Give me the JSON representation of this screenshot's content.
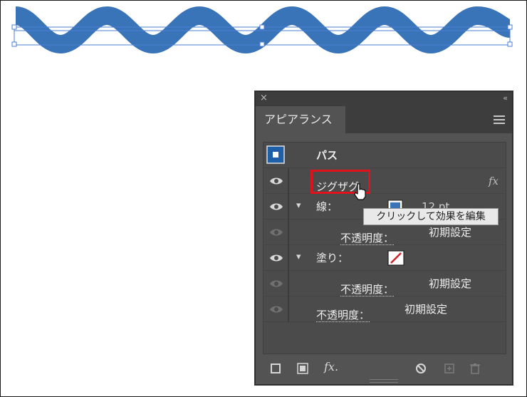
{
  "panel": {
    "tab_label": "アピアランス",
    "close_glyph": "×",
    "collapse_glyph": "‹‹"
  },
  "object": {
    "label": "パス"
  },
  "rows": {
    "effect_label": "ジグザグ",
    "fx_glyph": "fx",
    "stroke_label": "線：",
    "stroke_weight_partial": "12 pt",
    "stroke_opacity_label": "不透明度：",
    "stroke_opacity_value": "初期設定",
    "fill_label": "塗り：",
    "fill_opacity_label": "不透明度：",
    "fill_opacity_value": "初期設定",
    "object_opacity_label": "不透明度：",
    "object_opacity_value": "初期設定"
  },
  "tooltip": {
    "text": "クリックして効果を編集"
  },
  "bottom": {
    "fx_glyph": "fx."
  },
  "colors": {
    "wave": "#3a74b8",
    "selection": "#4a7fd6",
    "highlight": "#e0121c",
    "panel_bg": "#535353"
  }
}
